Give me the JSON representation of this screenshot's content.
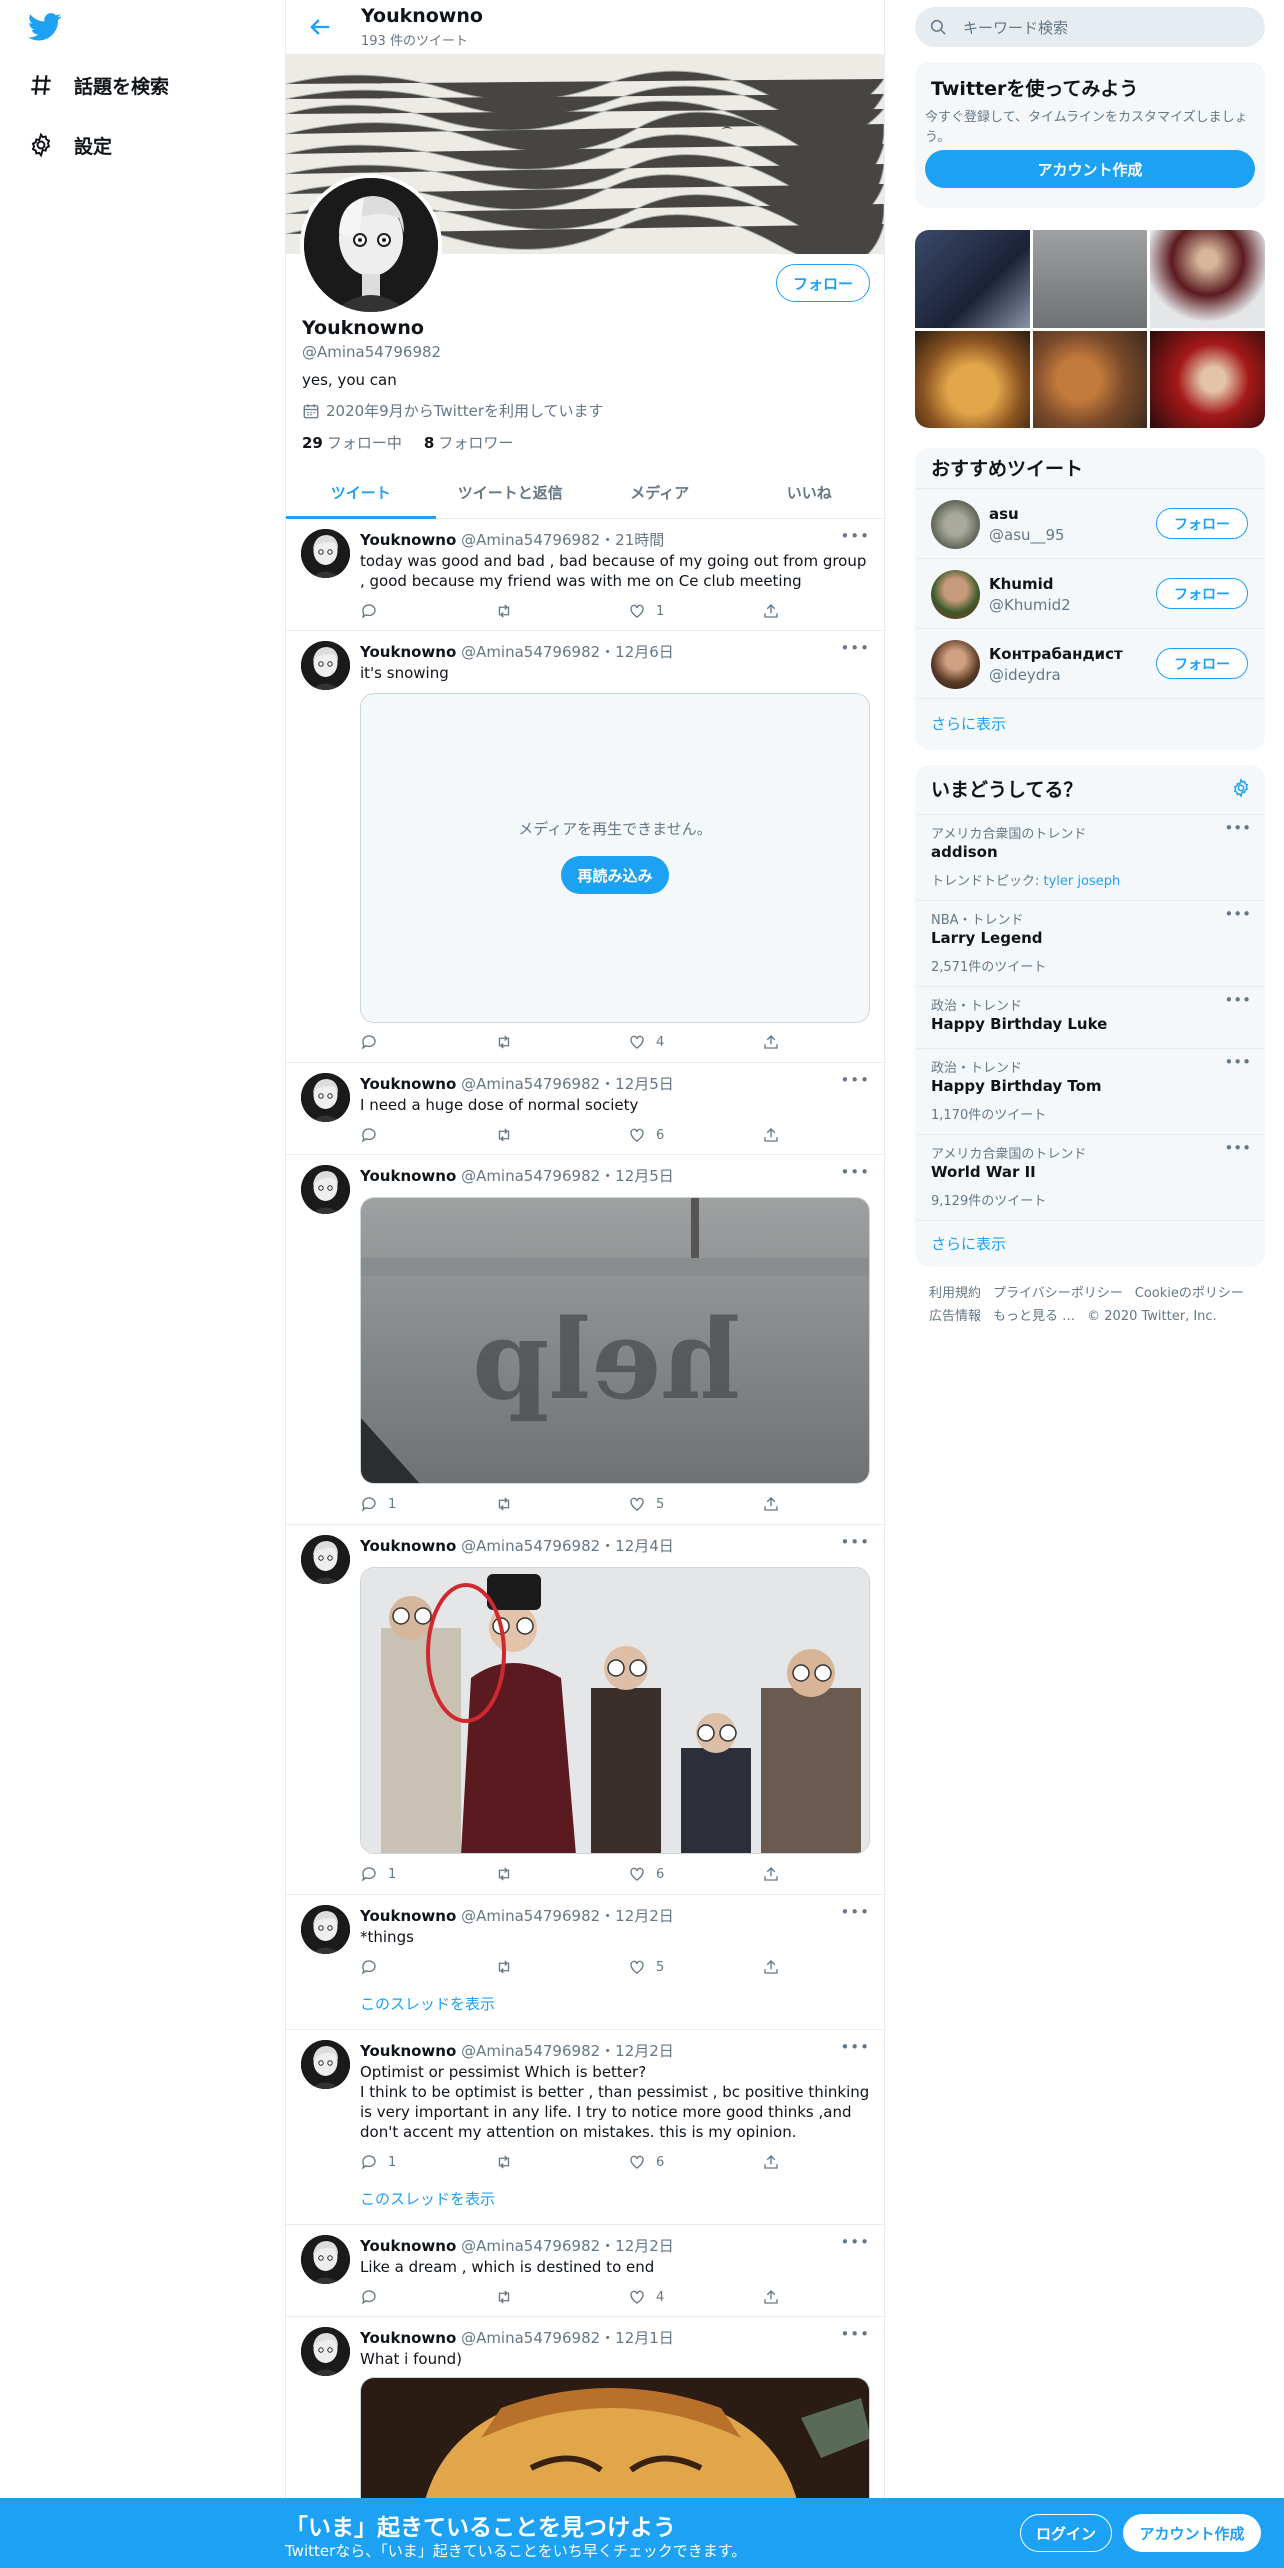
{
  "nav": {
    "items": [
      {
        "label": "話題を検索",
        "icon": "hashtag-icon"
      },
      {
        "label": "設定",
        "icon": "gear-icon"
      }
    ]
  },
  "profile_header": {
    "name": "Youknowno",
    "tweet_count": "193 件のツイート"
  },
  "profile": {
    "name": "Youknowno",
    "handle": "@Amina54796982",
    "bio": "yes, you can",
    "joined": "2020年9月からTwitterを利用しています",
    "following_count": "29",
    "following_label": "フォロー中",
    "followers_count": "8",
    "followers_label": "フォロワー",
    "follow_label": "フォロー"
  },
  "tabs": [
    "ツイート",
    "ツイートと返信",
    "メディア",
    "いいね"
  ],
  "tweets": [
    {
      "name": "Youknowno",
      "meta": "@Amina54796982・21時間",
      "text": "today was good and bad , bad because of  my going out from group , good because my friend was with me on Ce club meeting",
      "replies": "",
      "retweets": "",
      "likes": "1"
    },
    {
      "name": "Youknowno",
      "meta": "@Amina54796982・12月6日",
      "text": "it's snowing",
      "media_error": "メディアを再生できません。",
      "reload_label": "再読み込み",
      "replies": "",
      "retweets": "",
      "likes": "4"
    },
    {
      "name": "Youknowno",
      "meta": "@Amina54796982・12月5日",
      "text": "I need a huge dose of normal society",
      "replies": "",
      "retweets": "",
      "likes": "6"
    },
    {
      "name": "Youknowno",
      "meta": "@Amina54796982・12月5日",
      "text": "",
      "replies": "1",
      "retweets": "",
      "likes": "5"
    },
    {
      "name": "Youknowno",
      "meta": "@Amina54796982・12月4日",
      "text": "",
      "replies": "1",
      "retweets": "",
      "likes": "6"
    },
    {
      "name": "Youknowno",
      "meta": "@Amina54796982・12月2日",
      "text": "*things",
      "replies": "",
      "retweets": "",
      "likes": "5",
      "thread": "このスレッドを表示"
    },
    {
      "name": "Youknowno",
      "meta": "@Amina54796982・12月2日",
      "text": "Optimist or pessimist Which is better?\nI think to be optimist is better , than pessimist , bc positive thinking is very important in any life. I try to notice more good thinks ,and don't accent my attention on mistakes. this is my opinion.",
      "replies": "1",
      "retweets": "",
      "likes": "6",
      "thread": "このスレッドを表示"
    },
    {
      "name": "Youknowno",
      "meta": "@Amina54796982・12月2日",
      "text": "Like a dream , which is destined to end",
      "replies": "",
      "retweets": "",
      "likes": "4"
    },
    {
      "name": "Youknowno",
      "meta": "@Amina54796982・12月1日",
      "text": "What i found)"
    }
  ],
  "right": {
    "search_placeholder": "キーワード検索",
    "signup_title": "Twitterを使ってみよう",
    "signup_text": "今すぐ登録して、タイムラインをカスタマイズしましょう。",
    "signup_button": "アカウント作成",
    "recommend_title": "おすすめツイート",
    "recommend": [
      {
        "name": "asu",
        "handle": "@asu__95"
      },
      {
        "name": "Khumid",
        "handle": "@Khumid2"
      },
      {
        "name": "Контрабандист",
        "handle": "@ideydra"
      }
    ],
    "follow_label": "フォロー",
    "show_more": "さらに表示",
    "trends_title": "いまどうしてる？",
    "trends": [
      {
        "meta": "アメリカ合衆国のトレンド",
        "name": "addison",
        "extra_label": "トレンドトピック: ",
        "extra_link": "tyler joseph"
      },
      {
        "meta": "NBA・トレンド",
        "name": "Larry Legend",
        "count": "2,571件のツイート"
      },
      {
        "meta": "政治・トレンド",
        "name": "Happy Birthday Luke"
      },
      {
        "meta": "政治・トレンド",
        "name": "Happy Birthday Tom",
        "count": "1,170件のツイート"
      },
      {
        "meta": "アメリカ合衆国のトレンド",
        "name": "World War II",
        "count": "9,129件のツイート"
      }
    ],
    "trends_more": "さらに表示",
    "footer": [
      "利用規約",
      "プライバシーポリシー",
      "Cookieのポリシー",
      "広告情報",
      "もっと見る …",
      "© 2020 Twitter, Inc."
    ]
  },
  "bottom": {
    "title": "「いま」起きていることを見つけよう",
    "subtitle": "Twitterなら、「いま」起きていることをいち早くチェックできます。",
    "login": "ログイン",
    "signup": "アカウント作成"
  }
}
